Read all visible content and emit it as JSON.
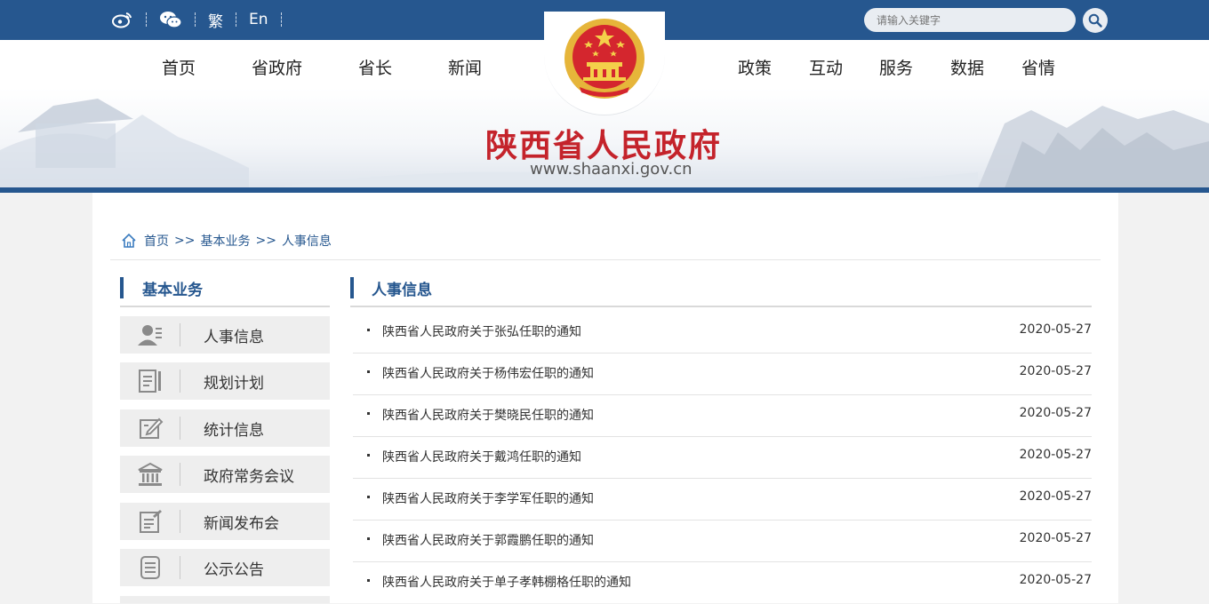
{
  "topbar": {
    "weibo_icon": "weibo-icon",
    "wechat_icon": "wechat-icon",
    "traditional": "繁",
    "english": "En",
    "search_placeholder": "请输入关键字"
  },
  "nav": {
    "left": [
      "首页",
      "省政府",
      "省长",
      "新闻"
    ],
    "right": [
      "政策",
      "互动",
      "服务",
      "数据",
      "省情"
    ]
  },
  "banner": {
    "title": "陕西省人民政府",
    "url": "www.shaanxi.gov.cn"
  },
  "breadcrumb": {
    "home": "首页",
    "sep1": ">>",
    "level1": "基本业务",
    "sep2": ">>",
    "level2": "人事信息"
  },
  "sidebar": {
    "title": "基本业务",
    "items": [
      {
        "label": "人事信息",
        "icon": "person-card-icon"
      },
      {
        "label": "规划计划",
        "icon": "document-icon"
      },
      {
        "label": "统计信息",
        "icon": "edit-icon"
      },
      {
        "label": "政府常务会议",
        "icon": "government-building-icon"
      },
      {
        "label": "新闻发布会",
        "icon": "press-release-icon"
      },
      {
        "label": "公示公告",
        "icon": "notice-icon"
      }
    ]
  },
  "main": {
    "title": "人事信息",
    "items": [
      {
        "title": "陕西省人民政府关于张弘任职的通知",
        "date": "2020-05-27"
      },
      {
        "title": "陕西省人民政府关于杨伟宏任职的通知",
        "date": "2020-05-27"
      },
      {
        "title": "陕西省人民政府关于樊晓民任职的通知",
        "date": "2020-05-27"
      },
      {
        "title": "陕西省人民政府关于戴鸿任职的通知",
        "date": "2020-05-27"
      },
      {
        "title": "陕西省人民政府关于李学军任职的通知",
        "date": "2020-05-27"
      },
      {
        "title": "陕西省人民政府关于郭霞鹏任职的通知",
        "date": "2020-05-27"
      },
      {
        "title": "陕西省人民政府关于单子孝韩棚格任职的通知",
        "date": "2020-05-27"
      }
    ]
  },
  "colors": {
    "brand_blue": "#26578f",
    "title_red": "#c4232b"
  }
}
